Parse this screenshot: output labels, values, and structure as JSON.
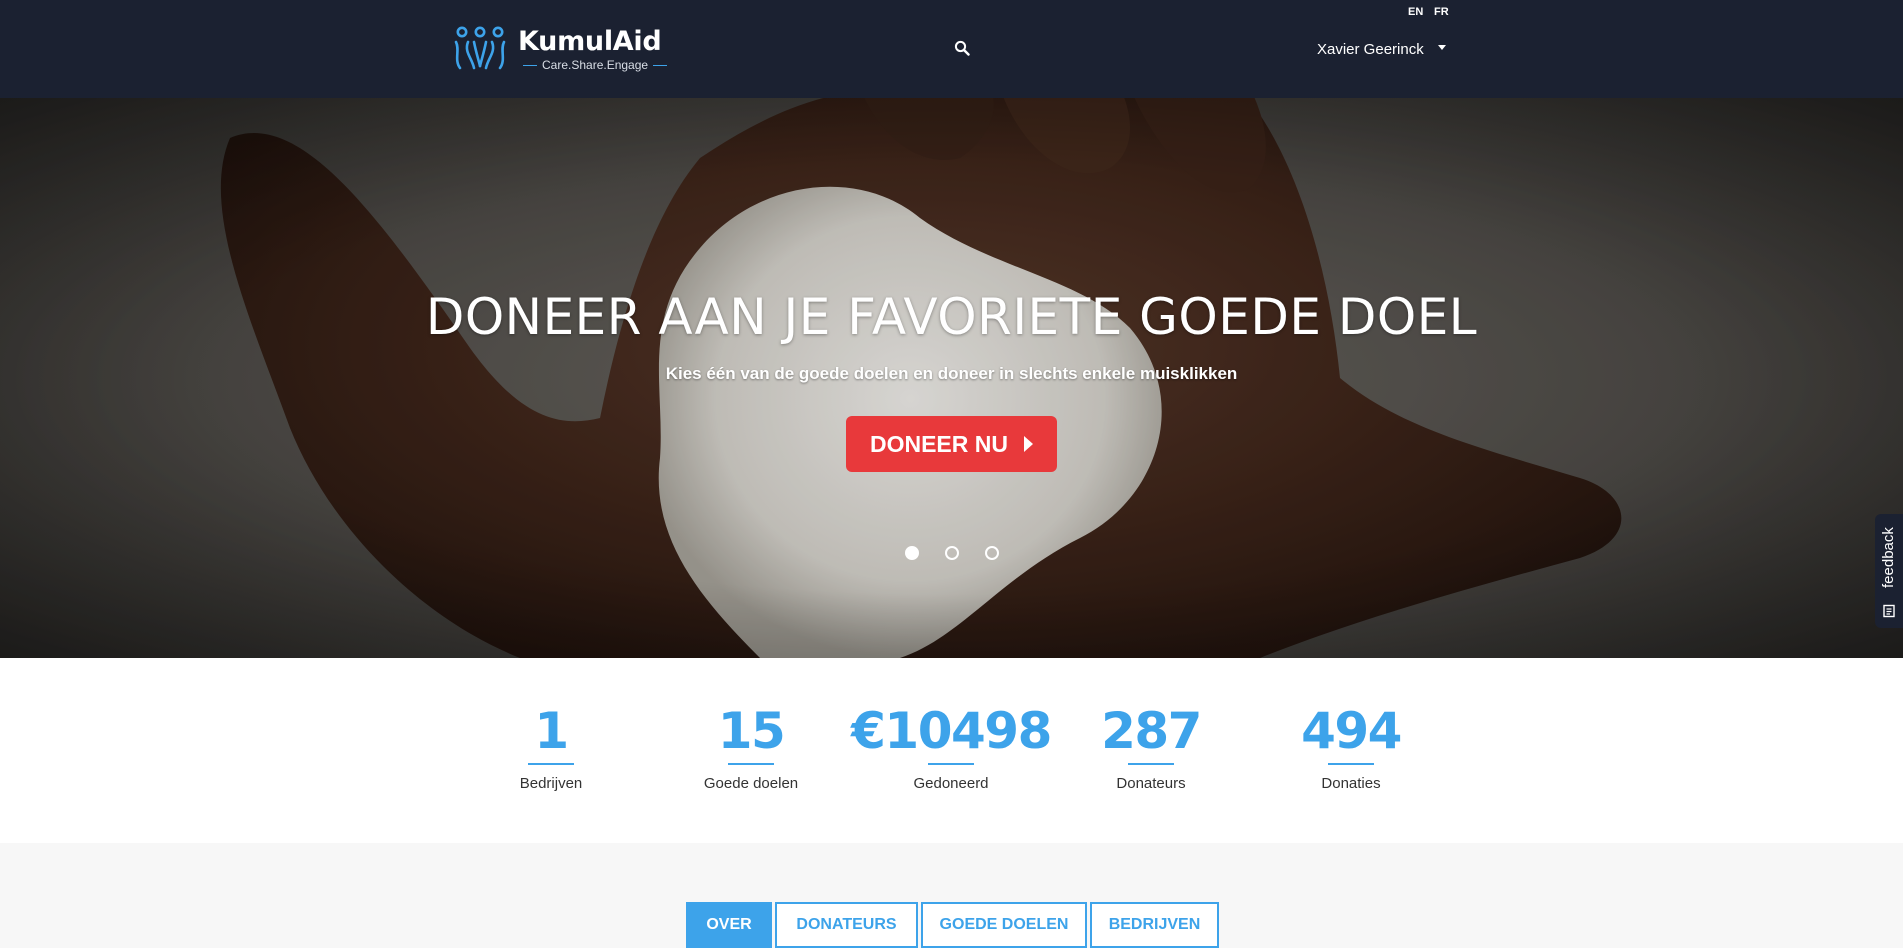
{
  "header": {
    "brand_name": "KumulAid",
    "tagline": "Care.Share.Engage",
    "languages": [
      "EN",
      "FR"
    ],
    "user_name": "Xavier Geerinck"
  },
  "hero": {
    "title": "DONEER AAN JE FAVORIETE GOEDE DOEL",
    "subtitle": "Kies één van de goede doelen en doneer in slechts enkele muisklikken",
    "cta_label": "DONEER NU",
    "slides_count": 3,
    "active_slide": 1
  },
  "feedback": {
    "label": "feedback"
  },
  "stats": [
    {
      "value": "1",
      "label": "Bedrijven"
    },
    {
      "value": "15",
      "label": "Goede doelen"
    },
    {
      "value": "€10498",
      "label": "Gedoneerd"
    },
    {
      "value": "287",
      "label": "Donateurs"
    },
    {
      "value": "494",
      "label": "Donaties"
    }
  ],
  "tabs": [
    {
      "label": "OVER",
      "active": true
    },
    {
      "label": "DONATEURS",
      "active": false
    },
    {
      "label": "GOEDE DOELEN",
      "active": false
    },
    {
      "label": "BEDRIJVEN",
      "active": false
    }
  ],
  "colors": {
    "header_bg": "#1b2131",
    "accent_blue": "#3da3ea",
    "cta_red": "#e8393b",
    "section_bg": "#f7f7f7"
  },
  "icons": {
    "logo": "people-logo-icon",
    "search": "search-icon",
    "user_caret": "caret-down-icon",
    "cta_arrow": "play-arrow-icon",
    "feedback": "notepad-icon"
  }
}
